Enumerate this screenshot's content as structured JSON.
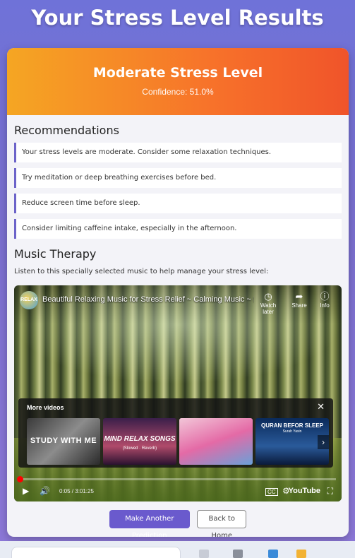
{
  "page": {
    "title": "Your Stress Level Results"
  },
  "result": {
    "level": "Moderate Stress Level",
    "confidence": "Confidence: 51.0%"
  },
  "recommendations": {
    "heading": "Recommendations",
    "items": [
      "Your stress levels are moderate. Consider some relaxation techniques.",
      "Try meditation or deep breathing exercises before bed.",
      "Reduce screen time before sleep.",
      "Consider limiting caffeine intake, especially in the afternoon."
    ]
  },
  "music": {
    "heading": "Music Therapy",
    "description": "Listen to this specially selected music to help manage your stress level:",
    "video": {
      "channel_logo_text": "RELAX",
      "title": "Beautiful Relaxing Music for Stress Relief ~ Calming Music ~ Me...",
      "watch_later": "Watch later",
      "share": "Share",
      "info": "Info",
      "more_videos": "More videos",
      "thumbnails": [
        {
          "text": "STUDY WITH ME",
          "sub": ""
        },
        {
          "text": "MIND RELAX SONGS",
          "sub": "(Slowed · Reverb)"
        },
        {
          "text": "",
          "sub": ""
        },
        {
          "text": "QURAN BEFOR SLEEP",
          "sub": "Surah Yasin"
        }
      ],
      "time": "0:05 / 3:01:25",
      "progress_fraction": 0.003,
      "youtube": "YouTube",
      "cc": "CC"
    }
  },
  "buttons": {
    "primary": "Make Another Prediction",
    "secondary": "Back to Home"
  },
  "colors": {
    "accent": "#6a5acd",
    "header_start": "#f5a623",
    "header_end": "#f0542a"
  }
}
